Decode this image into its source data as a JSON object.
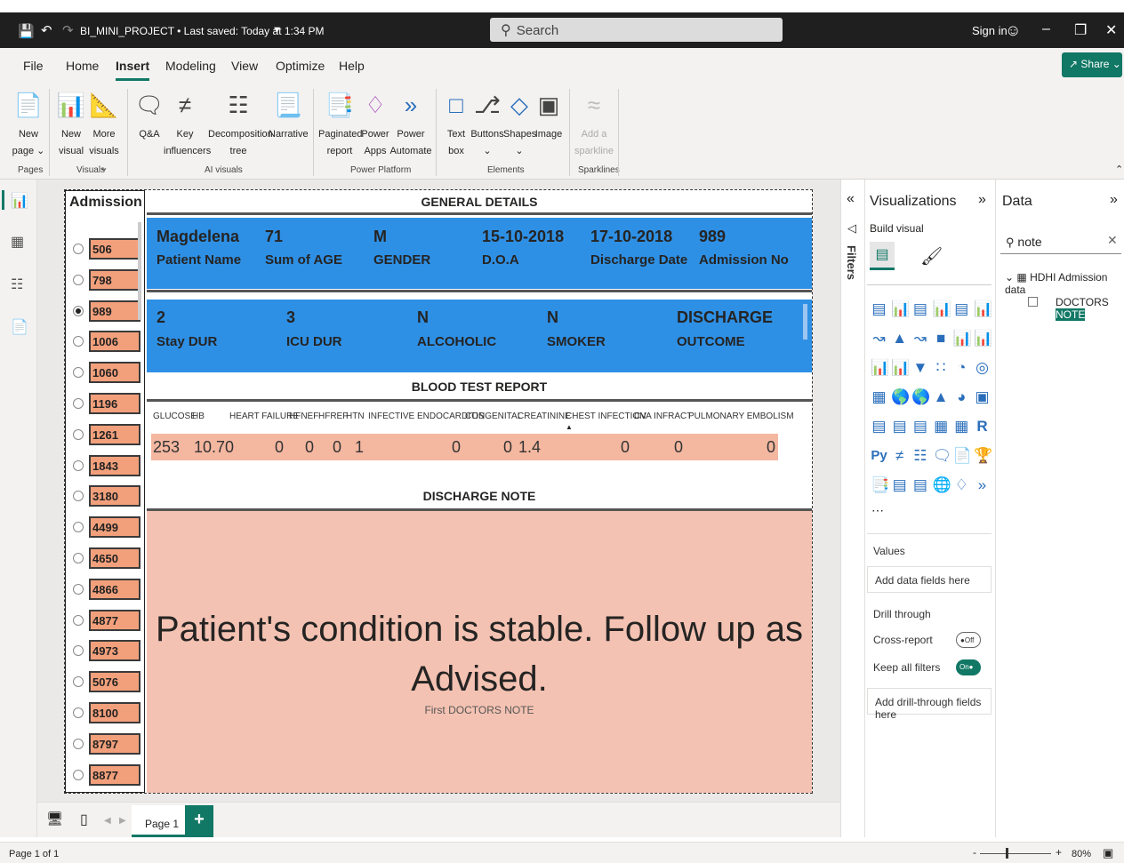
{
  "window": {
    "title": "BI_MINI_PROJECT • Last saved: Today at 1:34 PM",
    "search_placeholder": "Search",
    "sign_in": "Sign in"
  },
  "menu": [
    "File",
    "Home",
    "Insert",
    "Modeling",
    "View",
    "Optimize",
    "Help"
  ],
  "menu_active": "Insert",
  "share_label": "Share",
  "ribbon": {
    "new_page": [
      "New",
      "page"
    ],
    "new_visual": [
      "New",
      "visual"
    ],
    "more_visuals": [
      "More",
      "visuals"
    ],
    "qa": "Q&A",
    "key_influencers": [
      "Key",
      "influencers"
    ],
    "decomposition": [
      "Decomposition",
      "tree"
    ],
    "narrative": "Narrative",
    "paginated": [
      "Paginated",
      "report"
    ],
    "power_apps": [
      "Power",
      "Apps"
    ],
    "power_automate": [
      "Power",
      "Automate"
    ],
    "text_box": [
      "Text",
      "box"
    ],
    "buttons": "Buttons",
    "shapes": "Shapes",
    "image": "Image",
    "sparkline": [
      "Add a",
      "sparkline"
    ],
    "groups": {
      "pages": "Pages",
      "visuals": "Visuals",
      "ai": "AI visuals",
      "power": "Power Platform",
      "elements": "Elements",
      "sparklines": "Sparklines"
    }
  },
  "slicer": {
    "title": "Admission No",
    "items": [
      "506",
      "798",
      "989",
      "1006",
      "1060",
      "1196",
      "1261",
      "1843",
      "3180",
      "4499",
      "4650",
      "4866",
      "4877",
      "4973",
      "5076",
      "8100",
      "8797",
      "8877"
    ],
    "selected": "989"
  },
  "general": {
    "header": "GENERAL DETAILS",
    "card1": [
      {
        "value": "Magdelena",
        "label": "Patient Name"
      },
      {
        "value": "71",
        "label": "Sum of AGE"
      },
      {
        "value": "M",
        "label": "GENDER"
      },
      {
        "value": "15-10-2018",
        "label": "D.O.A"
      },
      {
        "value": "17-10-2018",
        "label": "Discharge Date"
      },
      {
        "value": "989",
        "label": "Admission No"
      }
    ],
    "card2": [
      {
        "value": "2",
        "label": "Stay DUR"
      },
      {
        "value": "3",
        "label": "ICU DUR"
      },
      {
        "value": "N",
        "label": "ALCOHOLIC"
      },
      {
        "value": "N",
        "label": "SMOKER"
      },
      {
        "value": "DISCHARGE",
        "label": "OUTCOME"
      }
    ]
  },
  "blood": {
    "header": "BLOOD TEST REPORT",
    "columns": [
      "GLUCOSE",
      "HB",
      "HEART FAILURE",
      "HFNEF",
      "HFREF",
      "HTN",
      "INFECTIVE ENDOCARDITIS",
      "CONGENITAL",
      "CREATININE",
      "CHEST INFECTION",
      "CVA INFRACT",
      "PULMONARY EMBOLISM"
    ],
    "values": [
      "253",
      "10.70",
      "0",
      "0",
      "0",
      "1",
      "0",
      "0",
      "1.4",
      "0",
      "0",
      "0"
    ]
  },
  "discharge": {
    "header": "DISCHARGE NOTE",
    "text_line1": "Patient's condition is stable. Follow up as",
    "text_line2": "Advised.",
    "caption": "First DOCTORS NOTE"
  },
  "filters_label": "Filters",
  "visualizations": {
    "title": "Visualizations",
    "build_visual": "Build visual",
    "values": "Values",
    "add_data": "Add data fields here",
    "drill_through": "Drill through",
    "cross_report": "Cross-report",
    "cross_state": "Off",
    "keep_filters": "Keep all filters",
    "keep_state": "On",
    "add_drill": "Add drill-through fields here",
    "r_label": "R",
    "py_label": "Py"
  },
  "data_pane": {
    "title": "Data",
    "search_value": "note",
    "table": "HDHI Admission data",
    "field_prefix": "DOCTORS ",
    "field_highlight": "NOTE"
  },
  "bottom": {
    "page_tab": "Page 1",
    "add": "+"
  },
  "status": {
    "page": "Page 1 of 1",
    "zoom": "80%"
  },
  "colors": {
    "accent": "#117865",
    "card_blue": "#2e90e5",
    "salmon": "#f4c2b2",
    "slicer_orange": "#f2a07b"
  }
}
